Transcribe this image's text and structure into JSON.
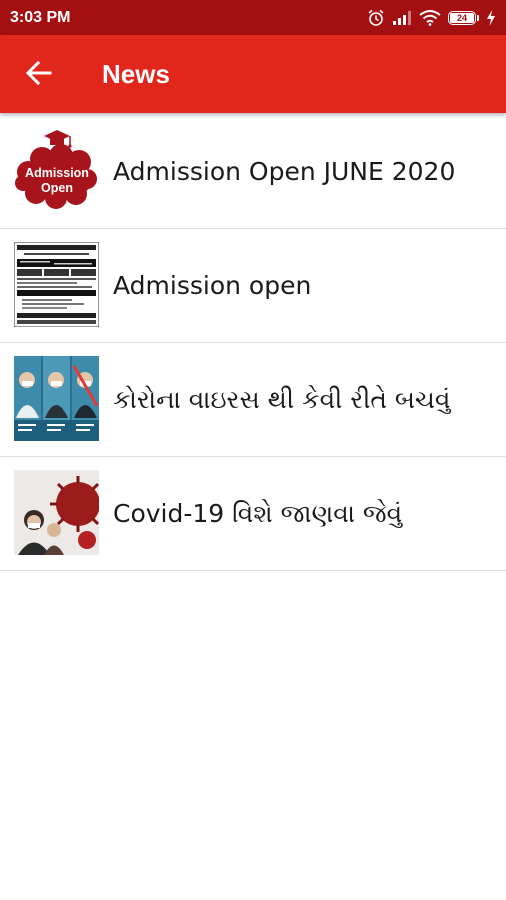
{
  "status_bar": {
    "time": "3:03 PM",
    "battery_level": "24"
  },
  "app_bar": {
    "title": "News"
  },
  "news": [
    {
      "title": "Admission Open JUNE 2020",
      "thumb_text_line1": "Admission",
      "thumb_text_line2": "Open"
    },
    {
      "title": "Admission open"
    },
    {
      "title": "કોરોના વાઇરસ થી કેવી રીતે બચવું"
    },
    {
      "title": "Covid-19  વિશે જાણવા જેવું"
    }
  ],
  "colors": {
    "status_bar": "#a40f12",
    "app_bar": "#e1261c",
    "thumb_red": "#a8141b"
  },
  "icons": [
    "back-arrow-icon",
    "alarm-icon",
    "signal-icon",
    "wifi-icon",
    "battery-icon",
    "charging-icon",
    "graduation-cap-icon"
  ]
}
